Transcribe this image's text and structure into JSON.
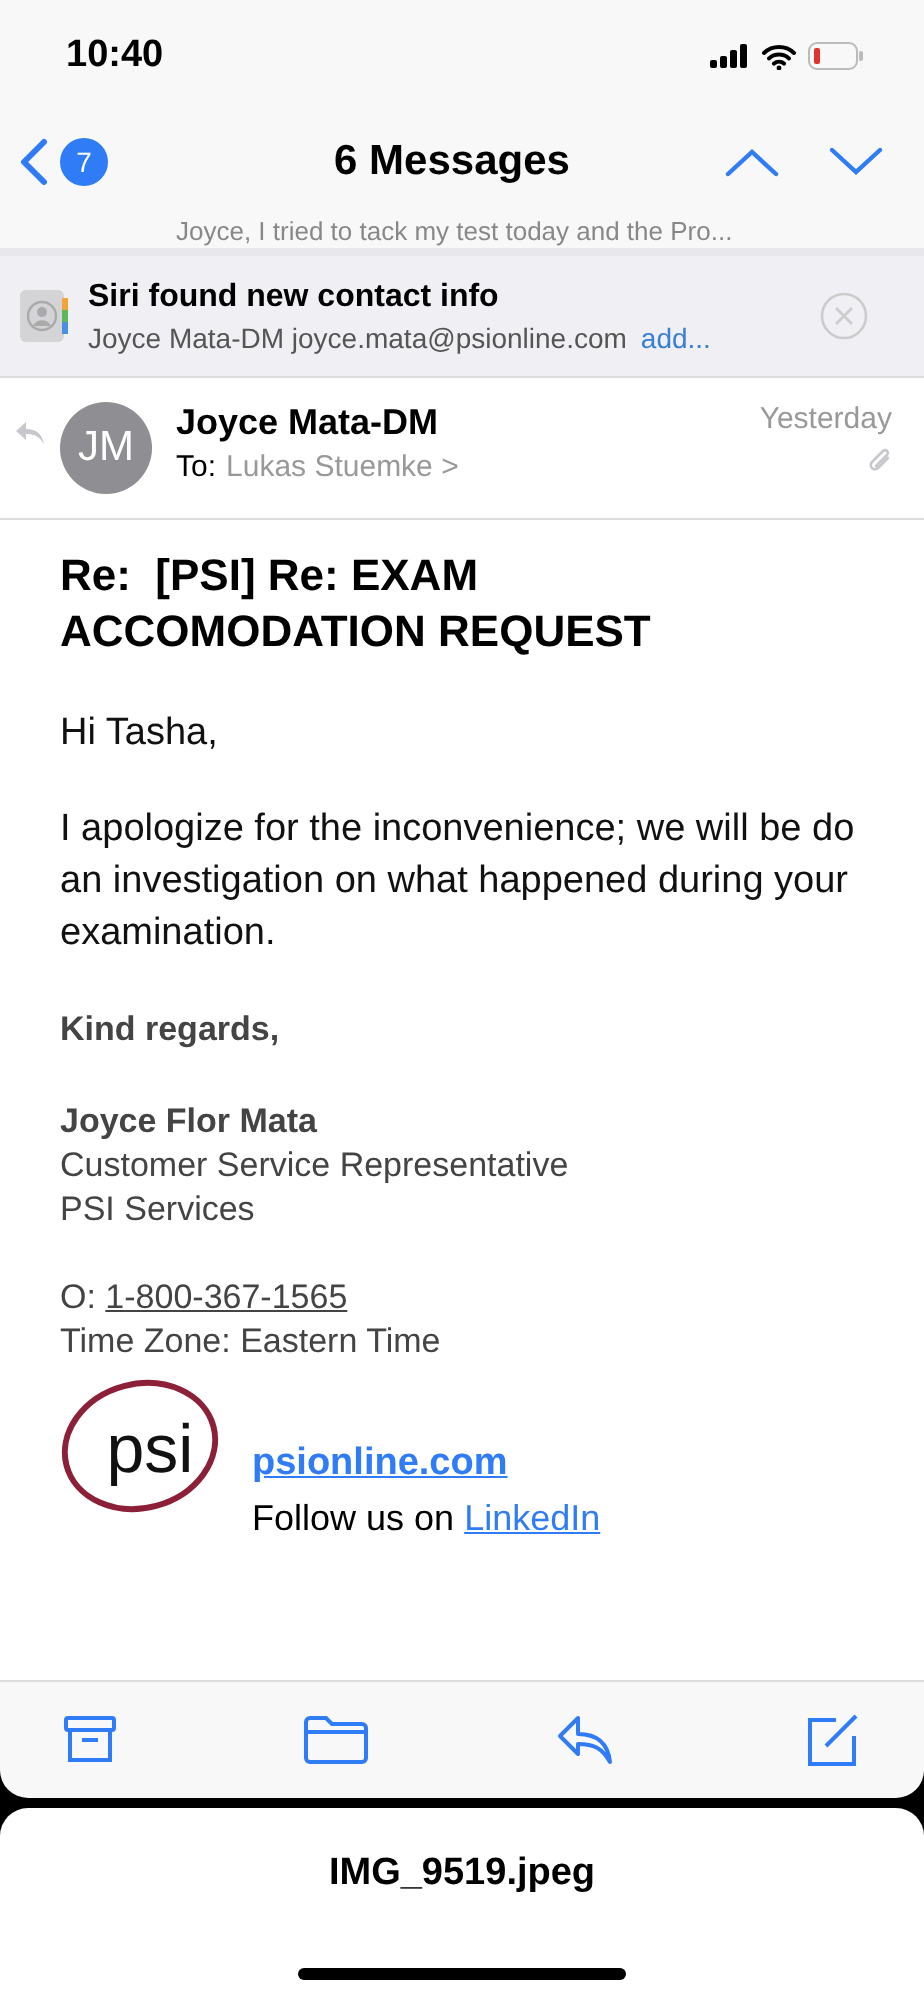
{
  "status_bar": {
    "time": "10:40"
  },
  "nav": {
    "badge": "7",
    "title": "6 Messages"
  },
  "previous_message": {
    "snippet": "Joyce, I tried to tack my test today and the Pro..."
  },
  "siri_banner": {
    "title": "Siri found new contact info",
    "contact": "Joyce Mata-DM joyce.mata@psionline.com",
    "action": "add..."
  },
  "message": {
    "initials": "JM",
    "sender": "Joyce Mata-DM",
    "to_label": "To:",
    "recipient": "Lukas Stuemke >",
    "date": "Yesterday",
    "replied": true,
    "has_attachment": true,
    "subject": "Re:  [PSI] Re: EXAM ACCOMODATION REQUEST",
    "body": [
      {
        "kind": "text",
        "text": "Hi Tasha,"
      },
      {
        "kind": "text",
        "text": "I apologize for the inconvenience; we will be do an investigation on what happened during your examination."
      },
      {
        "kind": "bold",
        "text": "Kind regards,"
      }
    ],
    "signature": {
      "name": "Joyce Flor Mata",
      "lines": [
        "Customer Service Representative",
        "PSI Services"
      ],
      "phone_label": "O: ",
      "phone": "1-800-367-1565",
      "time_zone": "Time Zone: Eastern Time",
      "logo_text": "psi",
      "website": "psionline.com",
      "follow_text": "Follow us on ",
      "follow_link": "LinkedIn"
    }
  },
  "attachment_sheet": {
    "filename": "IMG_9519.jpeg"
  }
}
